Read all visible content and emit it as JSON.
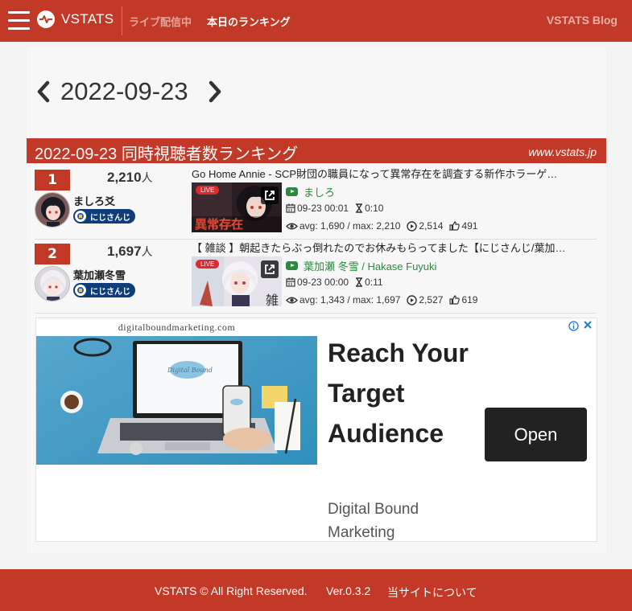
{
  "navbar": {
    "brand": "VSTATS",
    "nav_live": "ライブ配信中",
    "nav_ranking": "本日のランキング",
    "blog_link": "VSTATS Blog"
  },
  "date_nav": {
    "date": "2022-09-23"
  },
  "ranking_header": {
    "title": "2022-09-23 同時視聴者数ランキング",
    "site": "www.vstats.jp"
  },
  "entries": [
    {
      "rank": "1",
      "viewers": "2,210",
      "unit": "人",
      "name": "ましろ爻",
      "org": "にじさんじ",
      "title": "Go Home Annie - SCP財団の職員になって異常存在を調査する新作ホラーゲ…",
      "live_label": "LIVE",
      "channel": "ましろ",
      "start": "09-23 00:01",
      "duration": "0:10",
      "stats": "avg: 1,690 / max: 2,210",
      "views": "2,514",
      "likes": "491",
      "thumb_text": "異常存在"
    },
    {
      "rank": "2",
      "viewers": "1,697",
      "unit": "人",
      "name": "葉加瀬冬雪",
      "org": "にじさんじ",
      "title": "【 雑談 】朝起きたらぶっ倒れたのでお休みもらってました【にじさんじ/葉加…",
      "live_label": "LIVE",
      "channel": "葉加瀬 冬雪 / Hakase Fuyuki",
      "start": "09-23 00:00",
      "duration": "0:11",
      "stats": "avg: 1,343 / max: 1,697",
      "views": "2,527",
      "likes": "619",
      "thumb_text": "雑"
    }
  ],
  "ad": {
    "domain": "digitalboundmarketing.com",
    "headline": "Reach Your Target Audience",
    "advertiser": "Digital Bound Marketing",
    "cta": "Open",
    "laptop_logo": "Digital Bound"
  },
  "footer": {
    "copyright": "VSTATS © All Right Reserved.",
    "version": "Ver.0.3.2",
    "about": "当サイトについて"
  },
  "colors": {
    "brand_red": "#c23a27",
    "channel_green": "#2a8a3e",
    "org_navy": "#0e3d7a"
  }
}
